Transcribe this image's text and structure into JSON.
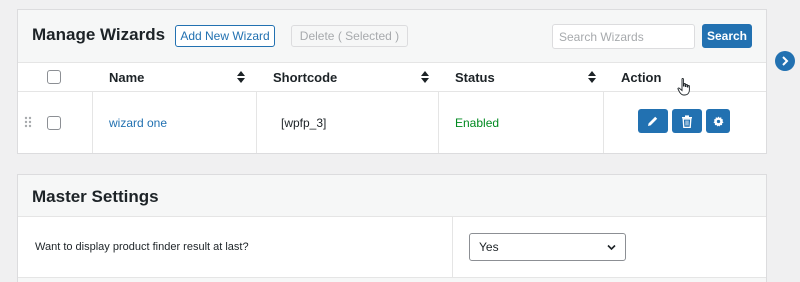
{
  "wizards": {
    "title": "Manage Wizards",
    "add_label": "Add New Wizard",
    "delete_label": "Delete ( Selected )",
    "search_placeholder": "Search Wizards",
    "search_label": "Search",
    "columns": [
      "Name",
      "Shortcode",
      "Status",
      "Action"
    ],
    "rows": [
      {
        "name": "wizard one",
        "shortcode": "[wpfp_3]",
        "status": "Enabled"
      }
    ],
    "action_icons": [
      "edit-icon",
      "trash-icon",
      "gear-icon"
    ]
  },
  "master": {
    "title": "Master Settings",
    "setting_label": "Want to display product finder result at last?",
    "setting_value": "Yes"
  },
  "colors": {
    "accent": "#2271b1",
    "status_enabled": "#008a20",
    "link": "#2271b1",
    "disabled_text": "#a7aaad"
  }
}
